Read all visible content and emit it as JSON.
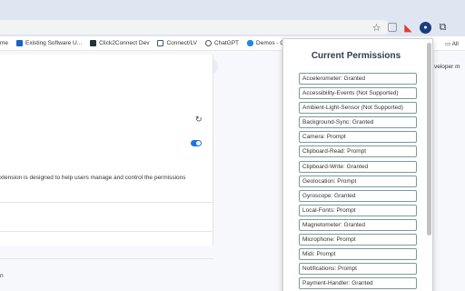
{
  "toolbar": {
    "icons": [
      "star-icon",
      "extension-icon",
      "puzzle-icon"
    ]
  },
  "bookmarks": [
    {
      "label": "me",
      "color": "#e53935"
    },
    {
      "label": "Existing Software U...",
      "color": "#1565c0"
    },
    {
      "label": "Click2Connect Dev",
      "color": "#263238"
    },
    {
      "label": "Connect/LV",
      "color": "#455a64"
    },
    {
      "label": "ChatGPT",
      "color": "#555555"
    },
    {
      "label": "Demos - OneDri",
      "color": "#1e88e5"
    }
  ],
  "bookmarks_right": "All",
  "page": {
    "right_label": "veloper m",
    "description": "xtension is designed to help users manage and control the permissions",
    "snippet": "n"
  },
  "popup": {
    "title": "Current Permissions",
    "permissions": [
      "Accelerometer: Granted",
      "Accessibility-Events (Not Supported)",
      "Ambient-Light-Sensor (Not Supported)",
      "Background-Sync: Granted",
      "Camera: Prompt",
      "Clipboard-Read: Prompt",
      "Clipboard-Write: Granted",
      "Geolocation: Prompt",
      "Gyroscope: Granted",
      "Local-Fonts: Prompt",
      "Magnetometer: Granted",
      "Microphone: Prompt",
      "Midi: Prompt",
      "Notifications: Prompt",
      "Payment-Handler: Granted"
    ]
  }
}
